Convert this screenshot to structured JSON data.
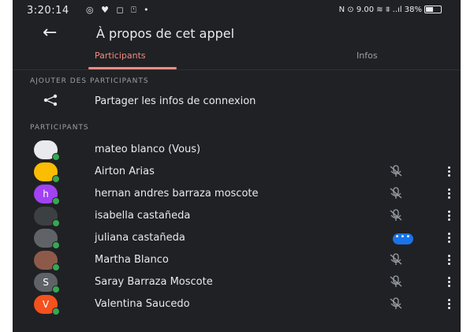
{
  "status_bar": {
    "time": "3:20:14",
    "icons": "◎ ♥ ◻ ⍞ •",
    "right_info": "N ⊙ 9.00 ≋ ⩨ ..ıl 38%"
  },
  "app_bar": {
    "title": "À propos de cet appel"
  },
  "tabs": [
    {
      "label": "Participants",
      "active": true
    },
    {
      "label": "Infos",
      "active": false
    }
  ],
  "add_section": {
    "header": "AJOUTER DES PARTICIPANTS",
    "share_label": "Partager les infos de connexion"
  },
  "participants_section": {
    "header": "PARTICIPANTS",
    "items": [
      {
        "name": "mateo blanco (Vous)",
        "avatar_text": "",
        "avatar_color": "#e8eaed",
        "state": "none"
      },
      {
        "name": "Airton Arias",
        "avatar_text": "",
        "avatar_color": "#fbbc04",
        "state": "muted"
      },
      {
        "name": "hernan andres barraza moscote",
        "avatar_text": "h",
        "avatar_color": "#a142f4",
        "state": "muted"
      },
      {
        "name": "isabella castañeda",
        "avatar_text": "",
        "avatar_color": "#3c4043",
        "state": "muted"
      },
      {
        "name": "juliana castañeda",
        "avatar_text": "",
        "avatar_color": "#5f6368",
        "state": "speaking"
      },
      {
        "name": "Martha Blanco",
        "avatar_text": "",
        "avatar_color": "#8d5a4a",
        "state": "muted"
      },
      {
        "name": "Saray Barraza Moscote",
        "avatar_text": "S",
        "avatar_color": "#5f6368",
        "state": "muted"
      },
      {
        "name": "Valentina Saucedo",
        "avatar_text": "V",
        "avatar_color": "#f4511e",
        "state": "muted"
      }
    ]
  },
  "colors": {
    "background": "#202124",
    "accent": "#f28b82",
    "online": "#34a853",
    "speaking": "#1a73e8"
  }
}
